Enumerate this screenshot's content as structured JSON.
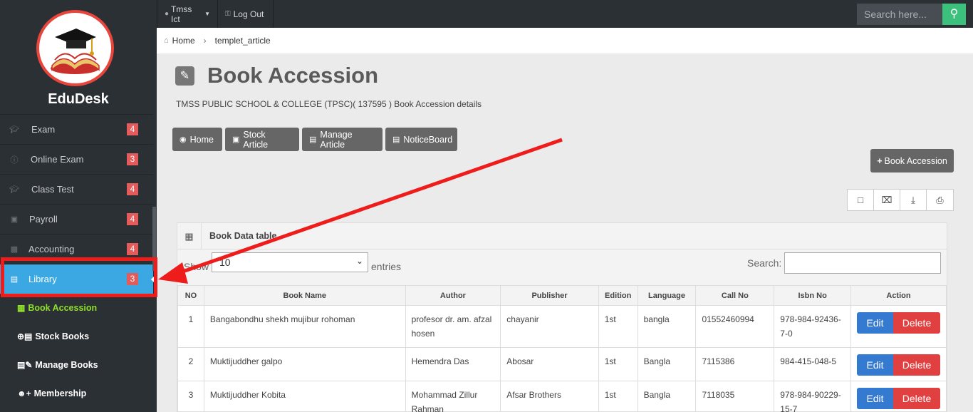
{
  "app": {
    "brand": "EduDesk"
  },
  "topbar": {
    "user_label": "Tmss Ict",
    "logout_label": "Log Out",
    "search_placeholder": "Search here..."
  },
  "breadcrumb": {
    "home": "Home",
    "current": "templet_article"
  },
  "sidebar": {
    "items": [
      {
        "label": "Exam",
        "badge": "4",
        "icon": "graduation-cap-icon"
      },
      {
        "label": "Online Exam",
        "badge": "3",
        "icon": "info-icon"
      },
      {
        "label": "Class Test",
        "badge": "4",
        "icon": "graduation-cap-icon"
      },
      {
        "label": "Payroll",
        "badge": "4",
        "icon": "money-icon"
      },
      {
        "label": "Accounting",
        "badge": "4",
        "icon": "briefcase-icon"
      },
      {
        "label": "Library",
        "badge": "3",
        "icon": "book-icon"
      }
    ],
    "submenu": [
      {
        "label": "Book Accession",
        "icon": "grid-icon"
      },
      {
        "label": "Stock Books",
        "icon": "stock-icon"
      },
      {
        "label": "Manage Books",
        "icon": "manage-books-icon"
      },
      {
        "label": "Membership",
        "icon": "user-plus-icon"
      }
    ]
  },
  "page": {
    "title": "Book Accession",
    "subtitle": "TMSS PUBLIC SCHOOL & COLLEGE (TPSC)( 137595 ) Book Accession details",
    "nav_buttons": [
      "Home",
      "Stock Article",
      "Manage Article",
      "NoticeBoard"
    ],
    "add_button": "Book Accession"
  },
  "panel": {
    "title": "Book Data table",
    "show_label": "Show",
    "entries_value": "10",
    "entries_label": "entries",
    "search_label": "Search:"
  },
  "table": {
    "headers": [
      "NO",
      "Book Name",
      "Author",
      "Publisher",
      "Edition",
      "Language",
      "Call No",
      "Isbn No",
      "Action"
    ],
    "rows": [
      {
        "no": "1",
        "name": "Bangabondhu shekh mujibur rohoman",
        "author": "profesor dr. am. afzal hosen",
        "publisher": "chayanir",
        "edition": "1st",
        "language": "bangla",
        "call_no": "01552460994",
        "isbn": "978-984-92436-7-0"
      },
      {
        "no": "2",
        "name": "Muktijuddher galpo",
        "author": "Hemendra Das",
        "publisher": "Abosar",
        "edition": "1st",
        "language": "Bangla",
        "call_no": "7115386",
        "isbn": "984-415-048-5"
      },
      {
        "no": "3",
        "name": "Muktijuddher Kobita",
        "author": "Mohammad Zillur Rahman",
        "publisher": "Afsar Brothers",
        "edition": "1st",
        "language": "Bangla",
        "call_no": "7118035",
        "isbn": "978-984-90229-15-7"
      }
    ],
    "edit_label": "Edit",
    "delete_label": "Delete"
  },
  "colors": {
    "sidebar_bg": "#2b3035",
    "active_item": "#3ba8e3",
    "badge": "#e35b5a",
    "highlight": "#ef1c1c",
    "submenu_current": "#8ee02a",
    "edit": "#337ad0",
    "delete": "#e04040",
    "search_button": "#3bc17b"
  }
}
